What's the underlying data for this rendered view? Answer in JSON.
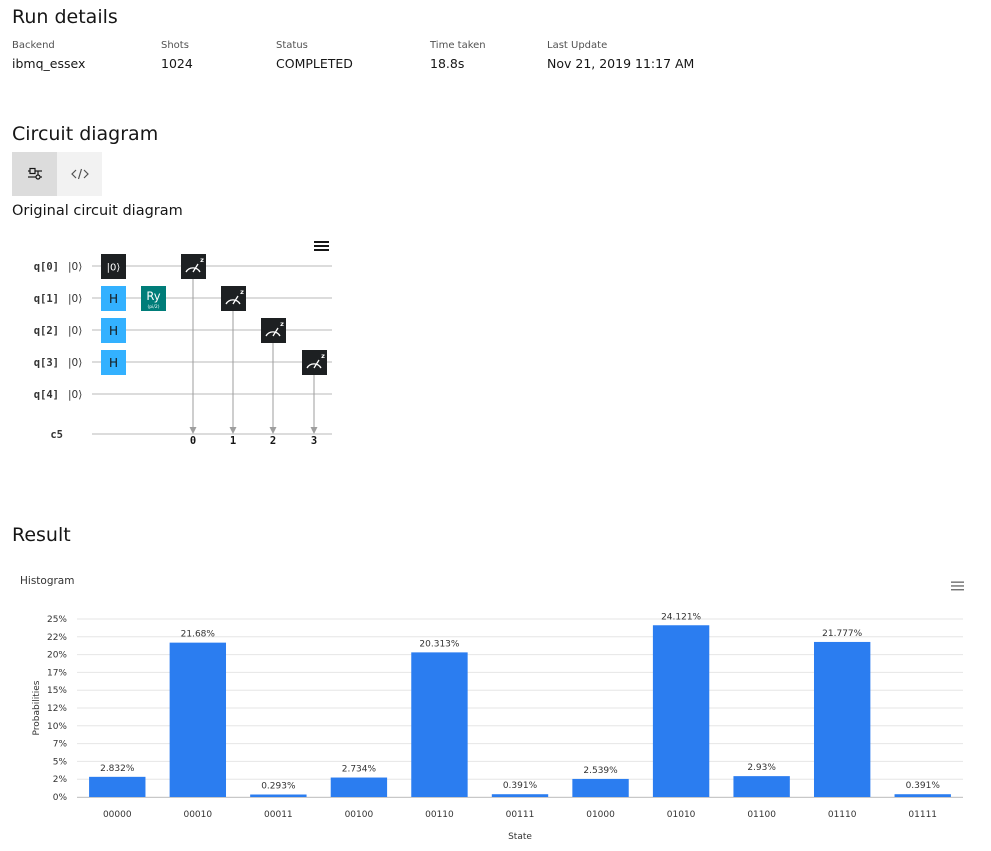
{
  "run_details": {
    "heading": "Run details",
    "fields": [
      {
        "label": "Backend",
        "value": "ibmq_essex"
      },
      {
        "label": "Shots",
        "value": "1024"
      },
      {
        "label": "Status",
        "value": "COMPLETED"
      },
      {
        "label": "Time taken",
        "value": "18.8s"
      },
      {
        "label": "Last Update",
        "value": "Nov 21, 2019 11:17 AM"
      }
    ]
  },
  "circuit": {
    "heading": "Circuit diagram",
    "tabs": [
      {
        "icon": "circuit-composer-icon",
        "active": true
      },
      {
        "icon": "code-icon",
        "active": false
      }
    ],
    "subtitle": "Original circuit diagram",
    "qubits": [
      {
        "name": "q[0]",
        "init": "|0⟩"
      },
      {
        "name": "q[1]",
        "init": "|0⟩"
      },
      {
        "name": "q[2]",
        "init": "|0⟩"
      },
      {
        "name": "q[3]",
        "init": "|0⟩"
      },
      {
        "name": "q[4]",
        "init": "|0⟩"
      }
    ],
    "classical": "c5",
    "reset_label": "|0⟩",
    "h_label": "H",
    "ry_label": "Ry",
    "ry_param": "(pi/2)",
    "measure_label": "z",
    "classical_bits": [
      "0",
      "1",
      "2",
      "3"
    ],
    "colors": {
      "hadamard": "#33b1ff",
      "ry": "#007d79",
      "measure": "#1d2022",
      "reset": "#1d2022"
    }
  },
  "result": {
    "heading": "Result",
    "chart_title": "Histogram"
  },
  "chart_data": {
    "type": "bar",
    "xlabel": "State",
    "ylabel": "Probabilities",
    "ylim": [
      0,
      25
    ],
    "yticks": [
      "0%",
      "2%",
      "5%",
      "7%",
      "10%",
      "12%",
      "15%",
      "17%",
      "20%",
      "22%",
      "25%"
    ],
    "ytick_values": [
      0,
      2.5,
      5,
      7.5,
      10,
      12.5,
      15,
      17.5,
      20,
      22.5,
      25
    ],
    "categories": [
      "00000",
      "00010",
      "00011",
      "00100",
      "00110",
      "00111",
      "01000",
      "01010",
      "01100",
      "01110",
      "01111"
    ],
    "values": [
      2.832,
      21.68,
      0.293,
      2.734,
      20.313,
      0.391,
      2.539,
      24.121,
      2.93,
      21.777,
      0.391
    ],
    "data_labels": [
      "2.832%",
      "21.68%",
      "0.293%",
      "2.734%",
      "20.313%",
      "0.391%",
      "2.539%",
      "24.121%",
      "2.93%",
      "21.777%",
      "0.391%"
    ],
    "bar_color": "#2b7df0",
    "grid": true
  }
}
